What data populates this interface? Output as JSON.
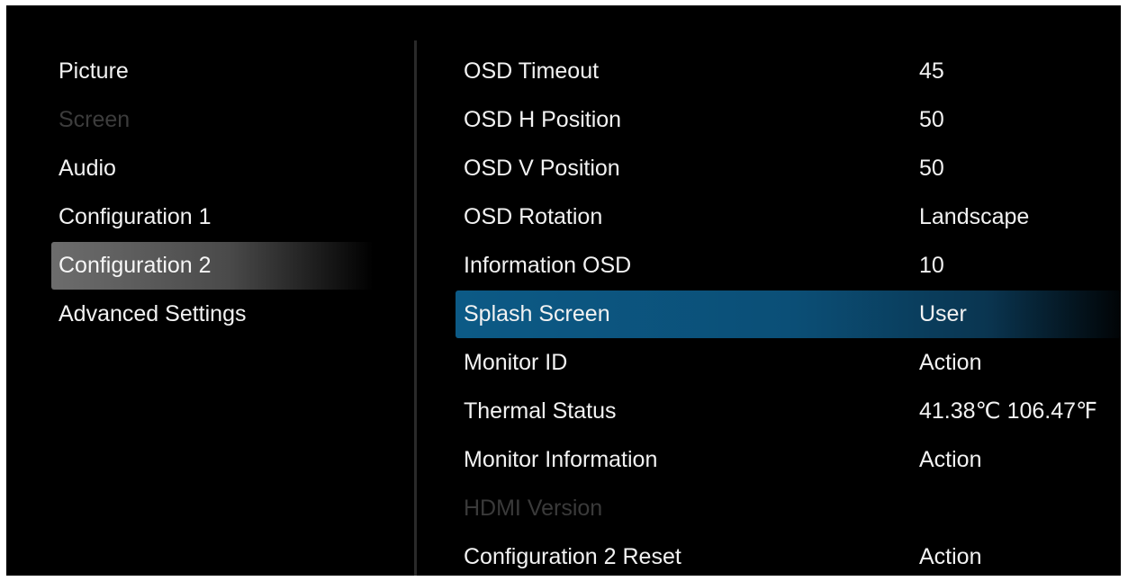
{
  "sidebar": {
    "items": [
      {
        "label": "Picture",
        "state": "normal"
      },
      {
        "label": "Screen",
        "state": "disabled"
      },
      {
        "label": "Audio",
        "state": "normal"
      },
      {
        "label": "Configuration 1",
        "state": "normal"
      },
      {
        "label": "Configuration 2",
        "state": "active"
      },
      {
        "label": "Advanced Settings",
        "state": "normal"
      }
    ]
  },
  "options": {
    "items": [
      {
        "label": "OSD Timeout",
        "value": "45",
        "state": "normal"
      },
      {
        "label": "OSD H Position",
        "value": "50",
        "state": "normal"
      },
      {
        "label": "OSD V Position",
        "value": "50",
        "state": "normal"
      },
      {
        "label": "OSD Rotation",
        "value": "Landscape",
        "state": "normal"
      },
      {
        "label": "Information OSD",
        "value": "10",
        "state": "normal"
      },
      {
        "label": "Splash Screen",
        "value": "User",
        "state": "selected"
      },
      {
        "label": "Monitor ID",
        "value": "Action",
        "state": "normal"
      },
      {
        "label": "Thermal Status",
        "value": "41.38℃ 106.47℉",
        "state": "normal"
      },
      {
        "label": "Monitor Information",
        "value": "Action",
        "state": "normal"
      },
      {
        "label": "HDMI Version",
        "value": "",
        "state": "disabled"
      },
      {
        "label": "Configuration 2 Reset",
        "value": "Action",
        "state": "normal"
      }
    ]
  },
  "colors": {
    "background": "#000000",
    "text": "#f2f2f2",
    "disabled_text": "#3a3a3a",
    "selection_blue": "#0c5a86",
    "active_gray": "#6d6d6d"
  }
}
